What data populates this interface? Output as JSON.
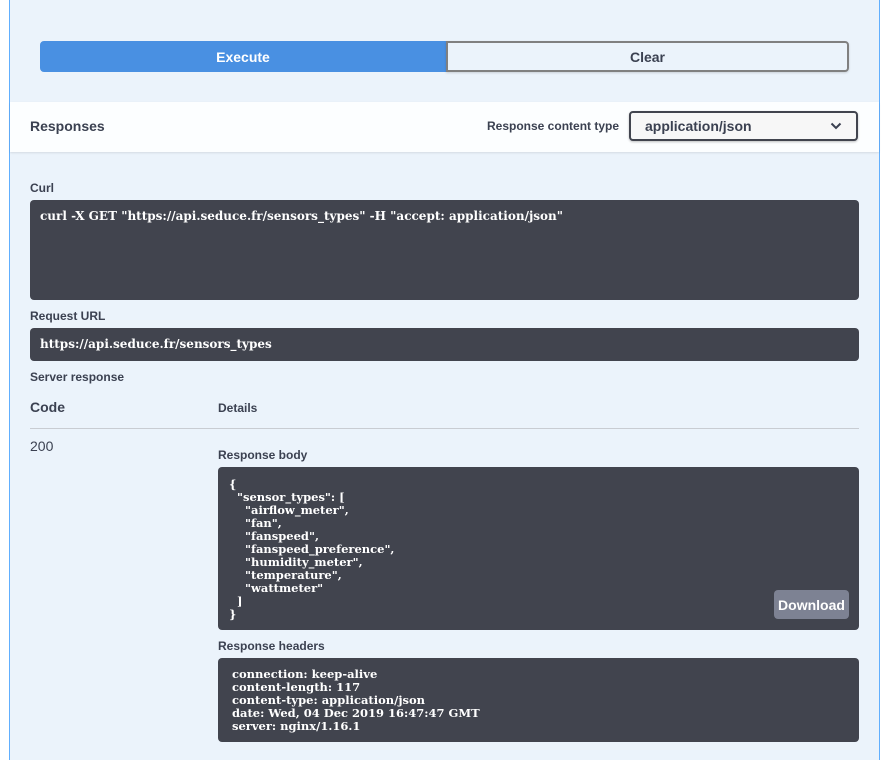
{
  "buttons": {
    "execute": "Execute",
    "clear": "Clear",
    "download": "Download"
  },
  "responses": {
    "title": "Responses",
    "content_type_label": "Response content type",
    "content_type_value": "application/json"
  },
  "curl": {
    "label": "Curl",
    "command": "curl -X GET \"https://api.seduce.fr/sensors_types\" -H \"accept: application/json\""
  },
  "request_url": {
    "label": "Request URL",
    "value": "https://api.seduce.fr/sensors_types"
  },
  "server_response": {
    "label": "Server response",
    "code_header": "Code",
    "details_header": "Details",
    "code": "200",
    "body_label": "Response body",
    "body": "{\n  \"sensor_types\": [\n    \"airflow_meter\",\n    \"fan\",\n    \"fanspeed\",\n    \"fanspeed_preference\",\n    \"humidity_meter\",\n    \"temperature\",\n    \"wattmeter\"\n  ]\n}",
    "headers_label": "Response headers",
    "headers": " connection: keep-alive \n content-length: 117 \n content-type: application/json \n date: Wed, 04 Dec 2019 16:47:47 GMT \n server: nginx/1.16.1 "
  },
  "colors": {
    "execute": "#4990e2",
    "panel_bg": "#ebf3fb",
    "code_bg": "#41444e"
  }
}
